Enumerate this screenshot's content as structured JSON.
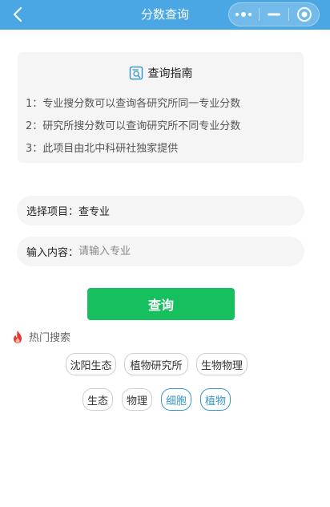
{
  "navbar": {
    "title": "分数查询"
  },
  "guide": {
    "title": "查询指南",
    "lines": [
      "1：专业搜分数可以查询各研究所同一专业分数",
      "2：研究所搜分数可以查询研究所不同专业分数",
      "3：此项目由北中科研社独家提供"
    ]
  },
  "form": {
    "project_label": "选择项目：",
    "project_value": "查专业",
    "content_label": "输入内容：",
    "content_placeholder": "请输入专业",
    "content_value": ""
  },
  "query_button": {
    "label": "查询",
    "color": "#16c05f"
  },
  "hot": {
    "label": "热门搜索",
    "row1": [
      "沈阳生态",
      "植物研究所",
      "生物物理"
    ],
    "row2": [
      "生态",
      "物理",
      "细胞",
      "植物"
    ]
  },
  "colors": {
    "navbar": "#4aa7e4",
    "accent_blue": "#3a98c9",
    "fire": "#e53935"
  }
}
